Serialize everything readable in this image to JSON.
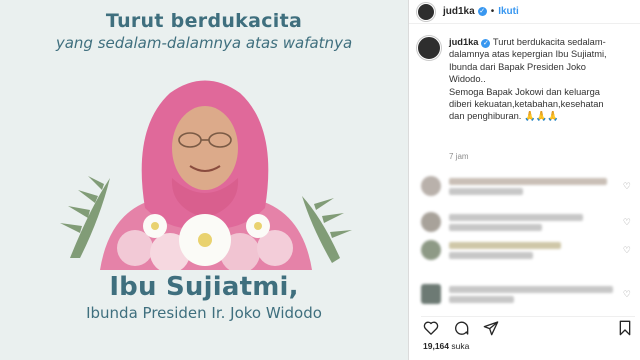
{
  "post_image": {
    "headline_line1": "Turut berdukacita",
    "headline_line2": "yang sedalam-dalamnya atas wafatnya",
    "name_line1": "Ibu Sujiatmi,",
    "name_line2": "Ibunda Presiden Ir. Joko Widodo"
  },
  "header": {
    "username": "jud1ka",
    "separator": "•",
    "follow_label": "Ikuti"
  },
  "caption": {
    "username": "jud1ka",
    "lines": [
      "Turut berdukacita sedalam-",
      "dalamnya atas kepergian Ibu Sujiatmi,",
      "Ibunda dari Bapak Presiden Joko",
      "Widodo..",
      "Semoga Bapak Jokowi dan keluarga",
      "diberi kekuatan,ketabahan,kesehatan",
      "dan penghiburan. 🙏🙏🙏"
    ],
    "time": "7 jam"
  },
  "likes": {
    "count": "19,164",
    "suffix": "suka"
  },
  "colors": {
    "accent_blue": "#3897f0",
    "headline_teal": "#3f6f7e",
    "muted_gray": "#8e8e8e"
  }
}
